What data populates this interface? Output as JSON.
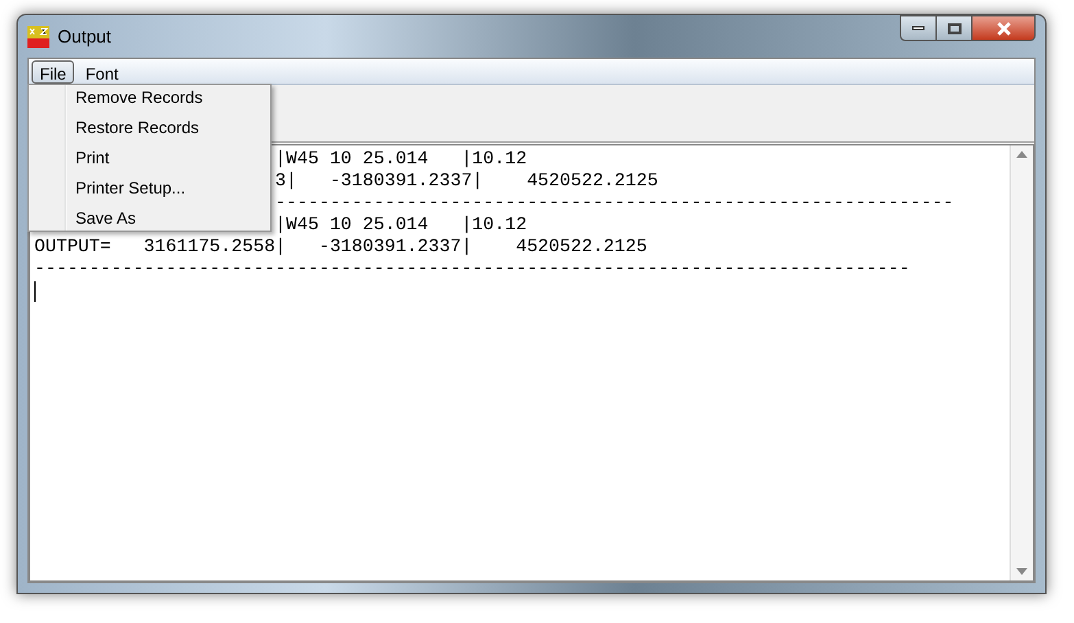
{
  "window": {
    "title": "Output"
  },
  "menubar": [
    {
      "label": "File",
      "selected": true
    },
    {
      "label": "Font",
      "selected": false
    }
  ],
  "file_menu": [
    "Remove Records",
    "Restore Records",
    "Print",
    "Printer Setup...",
    "Save As"
  ],
  "text_lines": [
    {
      "kind": "partial",
      "text": "|W45 10 25.014   |10.12"
    },
    {
      "kind": "partial",
      "text": "3|   -3180391.2337|    4520522.2125"
    },
    {
      "kind": "partial",
      "text": "--------------------------------------------------------------"
    },
    {
      "kind": "partial",
      "text": "|W45 10 25.014   |10.12"
    },
    {
      "kind": "full",
      "text": "OUTPUT=   3161175.2558|   -3180391.2337|    4520522.2125"
    },
    {
      "kind": "full",
      "text": "--------------------------------------------------------------------------------"
    }
  ]
}
